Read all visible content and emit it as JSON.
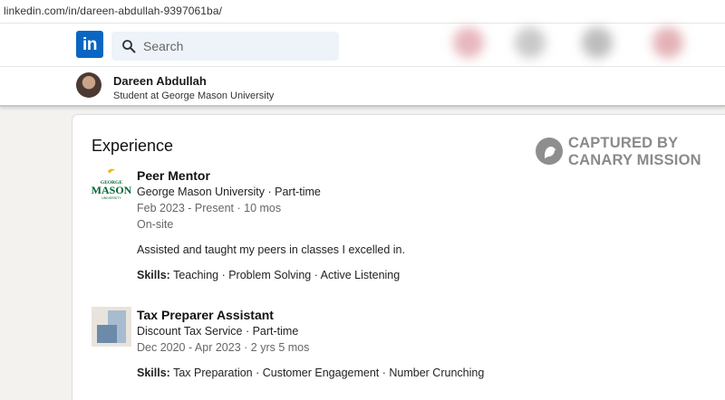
{
  "browser": {
    "url": "linkedin.com/in/dareen-abdullah-9397061ba/"
  },
  "topnav": {
    "logo_text": "in",
    "search_placeholder": "Search",
    "brand_color": "#0a66c2"
  },
  "profile_bar": {
    "name": "Dareen Abdullah",
    "tagline": "Student at George Mason University"
  },
  "experience": {
    "heading": "Experience",
    "watermark": {
      "line1": "CAPTURED BY",
      "line2": "CANARY MISSION"
    },
    "jobs": [
      {
        "logo": {
          "line1": "GEORGE",
          "line2": "MASON",
          "line3": "UNIVERSITY"
        },
        "title": "Peer Mentor",
        "company": "George Mason University · Part-time",
        "dates": "Feb 2023 - Present · 10 mos",
        "location": "On-site",
        "description": "Assisted and taught my peers in classes I excelled in.",
        "skills_label": "Skills:",
        "skills": " Teaching · Problem Solving · Active Listening"
      },
      {
        "title": "Tax Preparer Assistant",
        "company": "Discount Tax Service · Part-time",
        "dates": "Dec 2020 - Apr 2023 · 2 yrs 5 mos",
        "skills_label": "Skills:",
        "skills": " Tax Preparation · Customer Engagement · Number Crunching"
      }
    ]
  }
}
